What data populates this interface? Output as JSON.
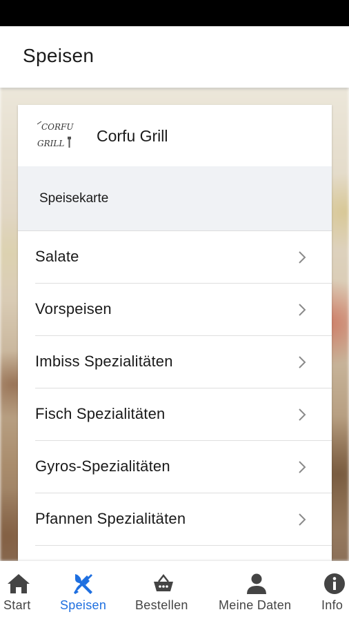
{
  "app_bar": {
    "title": "Speisen"
  },
  "restaurant": {
    "name": "Corfu Grill",
    "logo_text_line1": "CORFU",
    "logo_text_line2": "GRILL"
  },
  "section": {
    "title": "Speisekarte"
  },
  "menu": {
    "items": [
      {
        "label": "Salate"
      },
      {
        "label": "Vorspeisen"
      },
      {
        "label": "Imbiss Spezialitäten"
      },
      {
        "label": "Fisch Spezialitäten"
      },
      {
        "label": "Gyros-Spezialitäten"
      },
      {
        "label": "Pfannen Spezialitäten"
      }
    ]
  },
  "bottom_nav": {
    "items": [
      {
        "label": "Start",
        "icon": "home-icon",
        "active": false
      },
      {
        "label": "Speisen",
        "icon": "fork-knife-icon",
        "active": true
      },
      {
        "label": "Bestellen",
        "icon": "basket-icon",
        "active": false
      },
      {
        "label": "Meine Daten",
        "icon": "person-icon",
        "active": false
      },
      {
        "label": "Info",
        "icon": "info-icon",
        "active": false
      }
    ]
  },
  "colors": {
    "accent": "#1e6fe0",
    "nav_icon": "#444444",
    "section_header_bg": "#f0f2f5"
  }
}
